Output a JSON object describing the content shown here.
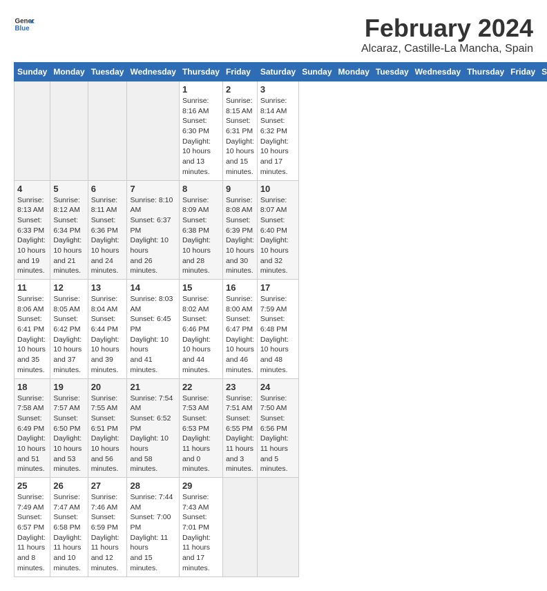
{
  "header": {
    "logo_line1": "General",
    "logo_line2": "Blue",
    "title": "February 2024",
    "subtitle": "Alcaraz, Castille-La Mancha, Spain"
  },
  "days_of_week": [
    "Sunday",
    "Monday",
    "Tuesday",
    "Wednesday",
    "Thursday",
    "Friday",
    "Saturday"
  ],
  "weeks": [
    [
      {
        "day": "",
        "info": ""
      },
      {
        "day": "",
        "info": ""
      },
      {
        "day": "",
        "info": ""
      },
      {
        "day": "",
        "info": ""
      },
      {
        "day": "1",
        "info": "Sunrise: 8:16 AM\nSunset: 6:30 PM\nDaylight: 10 hours\nand 13 minutes."
      },
      {
        "day": "2",
        "info": "Sunrise: 8:15 AM\nSunset: 6:31 PM\nDaylight: 10 hours\nand 15 minutes."
      },
      {
        "day": "3",
        "info": "Sunrise: 8:14 AM\nSunset: 6:32 PM\nDaylight: 10 hours\nand 17 minutes."
      }
    ],
    [
      {
        "day": "4",
        "info": "Sunrise: 8:13 AM\nSunset: 6:33 PM\nDaylight: 10 hours\nand 19 minutes."
      },
      {
        "day": "5",
        "info": "Sunrise: 8:12 AM\nSunset: 6:34 PM\nDaylight: 10 hours\nand 21 minutes."
      },
      {
        "day": "6",
        "info": "Sunrise: 8:11 AM\nSunset: 6:36 PM\nDaylight: 10 hours\nand 24 minutes."
      },
      {
        "day": "7",
        "info": "Sunrise: 8:10 AM\nSunset: 6:37 PM\nDaylight: 10 hours\nand 26 minutes."
      },
      {
        "day": "8",
        "info": "Sunrise: 8:09 AM\nSunset: 6:38 PM\nDaylight: 10 hours\nand 28 minutes."
      },
      {
        "day": "9",
        "info": "Sunrise: 8:08 AM\nSunset: 6:39 PM\nDaylight: 10 hours\nand 30 minutes."
      },
      {
        "day": "10",
        "info": "Sunrise: 8:07 AM\nSunset: 6:40 PM\nDaylight: 10 hours\nand 32 minutes."
      }
    ],
    [
      {
        "day": "11",
        "info": "Sunrise: 8:06 AM\nSunset: 6:41 PM\nDaylight: 10 hours\nand 35 minutes."
      },
      {
        "day": "12",
        "info": "Sunrise: 8:05 AM\nSunset: 6:42 PM\nDaylight: 10 hours\nand 37 minutes."
      },
      {
        "day": "13",
        "info": "Sunrise: 8:04 AM\nSunset: 6:44 PM\nDaylight: 10 hours\nand 39 minutes."
      },
      {
        "day": "14",
        "info": "Sunrise: 8:03 AM\nSunset: 6:45 PM\nDaylight: 10 hours\nand 41 minutes."
      },
      {
        "day": "15",
        "info": "Sunrise: 8:02 AM\nSunset: 6:46 PM\nDaylight: 10 hours\nand 44 minutes."
      },
      {
        "day": "16",
        "info": "Sunrise: 8:00 AM\nSunset: 6:47 PM\nDaylight: 10 hours\nand 46 minutes."
      },
      {
        "day": "17",
        "info": "Sunrise: 7:59 AM\nSunset: 6:48 PM\nDaylight: 10 hours\nand 48 minutes."
      }
    ],
    [
      {
        "day": "18",
        "info": "Sunrise: 7:58 AM\nSunset: 6:49 PM\nDaylight: 10 hours\nand 51 minutes."
      },
      {
        "day": "19",
        "info": "Sunrise: 7:57 AM\nSunset: 6:50 PM\nDaylight: 10 hours\nand 53 minutes."
      },
      {
        "day": "20",
        "info": "Sunrise: 7:55 AM\nSunset: 6:51 PM\nDaylight: 10 hours\nand 56 minutes."
      },
      {
        "day": "21",
        "info": "Sunrise: 7:54 AM\nSunset: 6:52 PM\nDaylight: 10 hours\nand 58 minutes."
      },
      {
        "day": "22",
        "info": "Sunrise: 7:53 AM\nSunset: 6:53 PM\nDaylight: 11 hours\nand 0 minutes."
      },
      {
        "day": "23",
        "info": "Sunrise: 7:51 AM\nSunset: 6:55 PM\nDaylight: 11 hours\nand 3 minutes."
      },
      {
        "day": "24",
        "info": "Sunrise: 7:50 AM\nSunset: 6:56 PM\nDaylight: 11 hours\nand 5 minutes."
      }
    ],
    [
      {
        "day": "25",
        "info": "Sunrise: 7:49 AM\nSunset: 6:57 PM\nDaylight: 11 hours\nand 8 minutes."
      },
      {
        "day": "26",
        "info": "Sunrise: 7:47 AM\nSunset: 6:58 PM\nDaylight: 11 hours\nand 10 minutes."
      },
      {
        "day": "27",
        "info": "Sunrise: 7:46 AM\nSunset: 6:59 PM\nDaylight: 11 hours\nand 12 minutes."
      },
      {
        "day": "28",
        "info": "Sunrise: 7:44 AM\nSunset: 7:00 PM\nDaylight: 11 hours\nand 15 minutes."
      },
      {
        "day": "29",
        "info": "Sunrise: 7:43 AM\nSunset: 7:01 PM\nDaylight: 11 hours\nand 17 minutes."
      },
      {
        "day": "",
        "info": ""
      },
      {
        "day": "",
        "info": ""
      }
    ]
  ]
}
